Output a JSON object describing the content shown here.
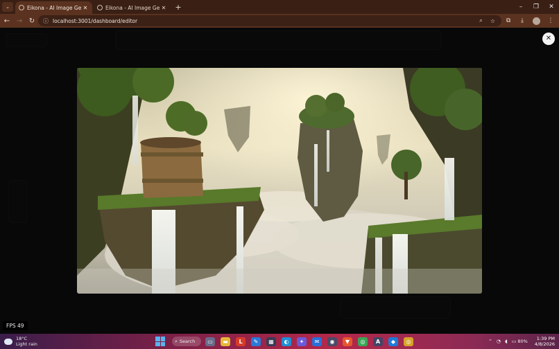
{
  "browser": {
    "tabs": [
      {
        "title": "Eikona - AI Image Generation S",
        "active": true
      },
      {
        "title": "Eikona - AI Image Generation S",
        "active": false
      }
    ],
    "new_tab": "+",
    "url": "localhost:3001/dashboard/editor",
    "window_controls": {
      "minimize": "–",
      "restore": "❐",
      "close": "✕"
    }
  },
  "page": {
    "modal_close": "✕",
    "image_alt": "Fantasy landscape with floating cliffs, waterfalls, a wooden bucket on a mossy island and a sea of clouds",
    "fps_label": "FPS 49"
  },
  "taskbar": {
    "weather_temp": "18°C",
    "weather_desc": "Light rain",
    "search_label": "Search",
    "time": "1:39 PM",
    "date": "4/8/2026",
    "battery": "80%",
    "apps": [
      {
        "name": "task-view",
        "glyph": "▭",
        "color": "#6b6b8a"
      },
      {
        "name": "file-explorer",
        "glyph": "▬",
        "color": "#e6b73a"
      },
      {
        "name": "app-l",
        "glyph": "L",
        "color": "#d83a2a"
      },
      {
        "name": "app-draw",
        "glyph": "✎",
        "color": "#2a78d8"
      },
      {
        "name": "app-store",
        "glyph": "▦",
        "color": "#3a3a55"
      },
      {
        "name": "edge",
        "glyph": "◐",
        "color": "#1e8fd6"
      },
      {
        "name": "app-copilot",
        "glyph": "✦",
        "color": "#6a5ad8"
      },
      {
        "name": "mail",
        "glyph": "✉",
        "color": "#2a6fd8"
      },
      {
        "name": "camera",
        "glyph": "◉",
        "color": "#4a4a66"
      },
      {
        "name": "brave",
        "glyph": "▼",
        "color": "#e4572e"
      },
      {
        "name": "chrome",
        "glyph": "◎",
        "color": "#3aa655"
      },
      {
        "name": "app-a",
        "glyph": "A",
        "color": "#444466"
      },
      {
        "name": "vscode",
        "glyph": "◆",
        "color": "#1f7ad8"
      },
      {
        "name": "chrome-2",
        "glyph": "◎",
        "color": "#d8a32a"
      }
    ]
  }
}
